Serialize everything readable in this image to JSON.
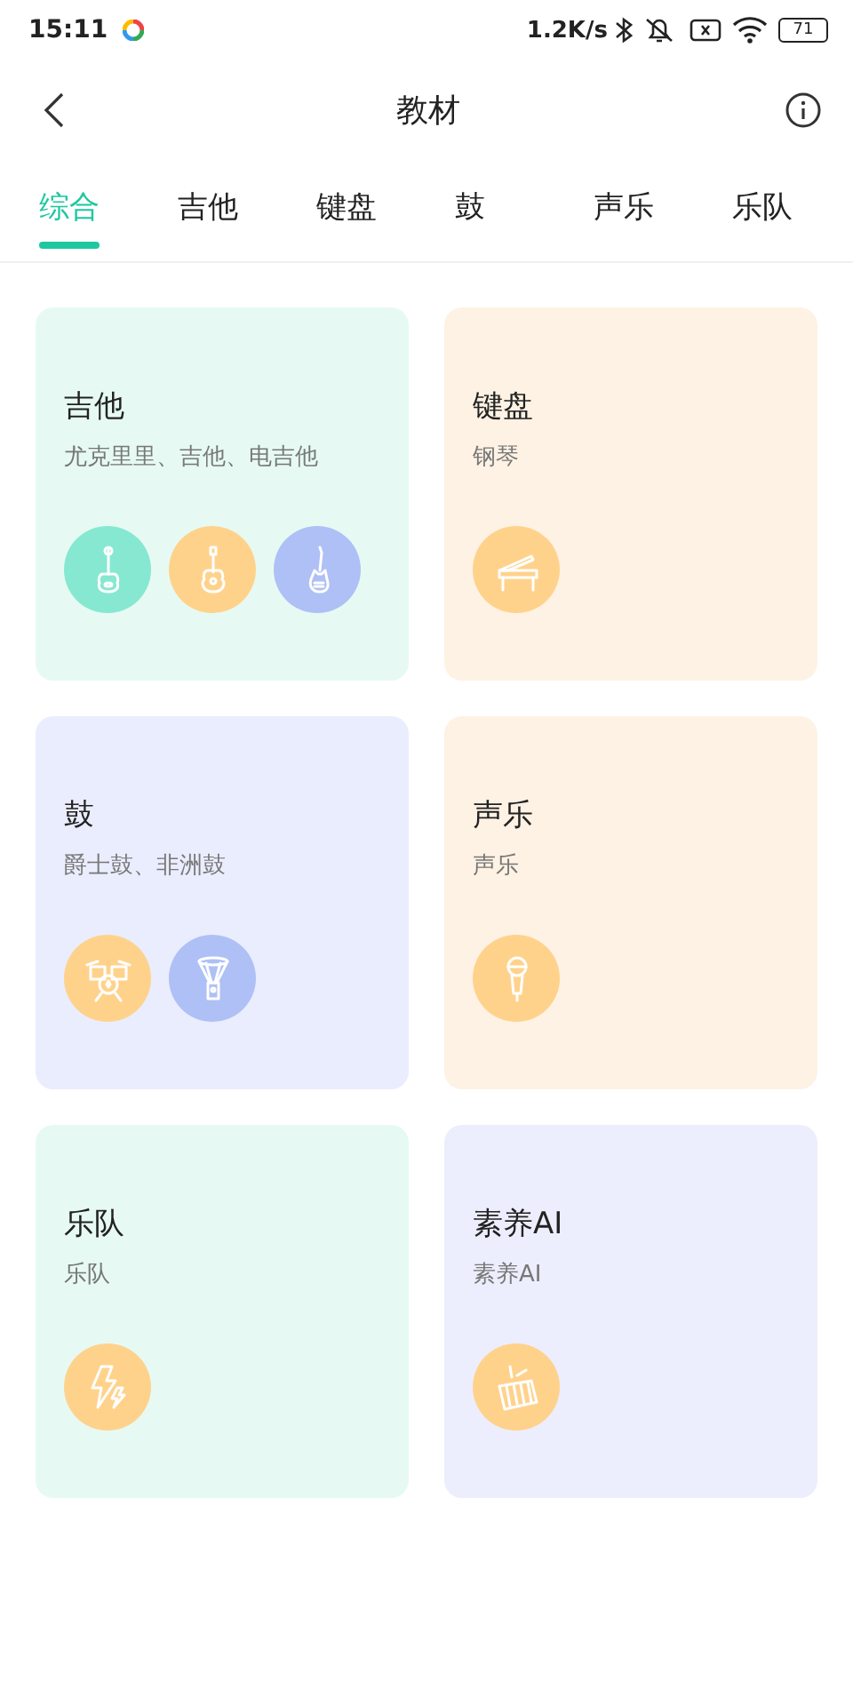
{
  "status_bar": {
    "time": "15:11",
    "net_speed": "1.2K/s",
    "battery": "71"
  },
  "header": {
    "title": "教材"
  },
  "tabs": [
    {
      "label": "综合",
      "selected": true
    },
    {
      "label": "吉他",
      "selected": false
    },
    {
      "label": "键盘",
      "selected": false
    },
    {
      "label": "鼓",
      "selected": false
    },
    {
      "label": "声乐",
      "selected": false
    },
    {
      "label": "乐队",
      "selected": false
    }
  ],
  "cards": [
    {
      "title": "吉他",
      "subtitle": "尤克里里、吉他、电吉他",
      "color": "#e6faf3",
      "icons": [
        {
          "kind": "ukulele",
          "color": "#86e8d0"
        },
        {
          "kind": "guitar",
          "color": "#ffd28c"
        },
        {
          "kind": "bass",
          "color": "#aec0f5"
        }
      ]
    },
    {
      "title": "键盘",
      "subtitle": "钢琴",
      "color": "#fef2e4",
      "icons": [
        {
          "kind": "piano",
          "color": "#ffd28c"
        }
      ]
    },
    {
      "title": "鼓",
      "subtitle": "爵士鼓、非洲鼓",
      "color": "#eaedfd",
      "icons": [
        {
          "kind": "drumkit",
          "color": "#ffd28c"
        },
        {
          "kind": "djembe",
          "color": "#aec0f5"
        }
      ]
    },
    {
      "title": "声乐",
      "subtitle": "声乐",
      "color": "#fef2e4",
      "icons": [
        {
          "kind": "microphone",
          "color": "#ffd28c"
        }
      ]
    },
    {
      "title": "乐队",
      "subtitle": "乐队",
      "color": "#e6faf3",
      "icons": [
        {
          "kind": "lightning",
          "color": "#ffd28c"
        }
      ]
    },
    {
      "title": "素养AI",
      "subtitle": "素养AI",
      "color": "#eceefd",
      "icons": [
        {
          "kind": "xylophone",
          "color": "#ffd28c"
        }
      ]
    }
  ]
}
